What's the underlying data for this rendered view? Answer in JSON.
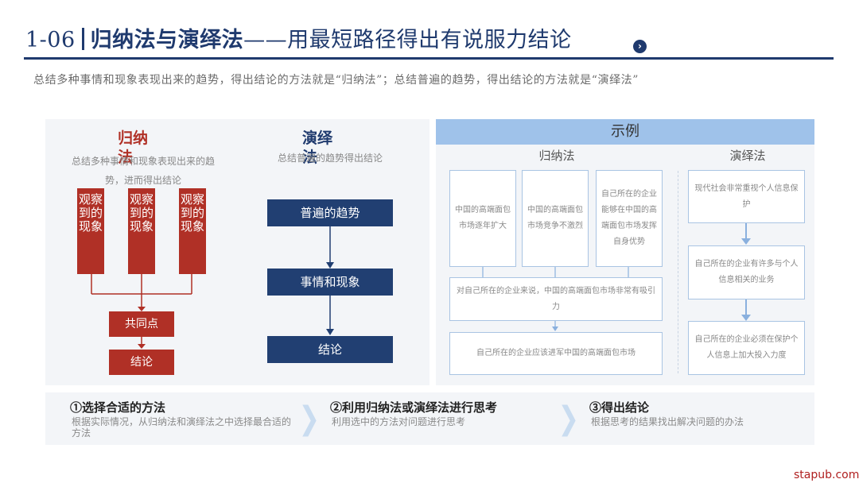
{
  "header": {
    "number": "1-06",
    "title": "归纳法与演绎法",
    "subtitle": "——用最短路径得出有说服力结论",
    "nav_icon": "chevron-right-icon"
  },
  "intro": "总结多种事情和现象表现出来的趋势，得出结论的方法就是“归纳法”；总结普遍的趋势，得出结论的方法就是“演绎法”",
  "induction": {
    "title": "归纳法",
    "description": "总结多种事情和现象表现出来的趋势，进而得出结论",
    "observations": [
      "观察到的现象",
      "观察到的现象",
      "观察到的现象"
    ],
    "common_point": "共同点",
    "conclusion": "结论"
  },
  "deduction": {
    "title": "演绎法",
    "description": "总结普遍的趋势得出结论",
    "steps": [
      "普遍的趋势",
      "事情和现象",
      "结论"
    ]
  },
  "example": {
    "header": "示例",
    "induction_label": "归纳法",
    "deduction_label": "演绎法",
    "induction_facts": [
      "中国的高端面包市场逐年扩大",
      "中国的高端面包市场竞争不激烈",
      "自己所在的企业能够在中国的高端面包市场发挥自身优势"
    ],
    "induction_common": "对自己所在的企业来说，中国的高端面包市场非常有吸引力",
    "induction_conclusion": "自己所在的企业应该进军中国的高端面包市场",
    "deduction_steps": [
      "现代社会非常重视个人信息保护",
      "自己所在的企业有许多与个人信息相关的业务",
      "自己所在的企业必须在保护个人信息上加大投入力度"
    ]
  },
  "steps": [
    {
      "title": "①选择合适的方法",
      "desc": "根据实际情况，从归纳法和演绎法之中选择最合适的方法"
    },
    {
      "title": "②利用归纳法或演绎法进行思考",
      "desc": "利用选中的方法对问题进行思考"
    },
    {
      "title": "③得出结论",
      "desc": "根据思考的结果找出解决问题的办法"
    }
  ],
  "watermark": "stapub.com",
  "colors": {
    "navy": "#1f3a6e",
    "red": "#b03026",
    "light_blue": "#9fc2ea",
    "panel": "#f3f5f8"
  }
}
